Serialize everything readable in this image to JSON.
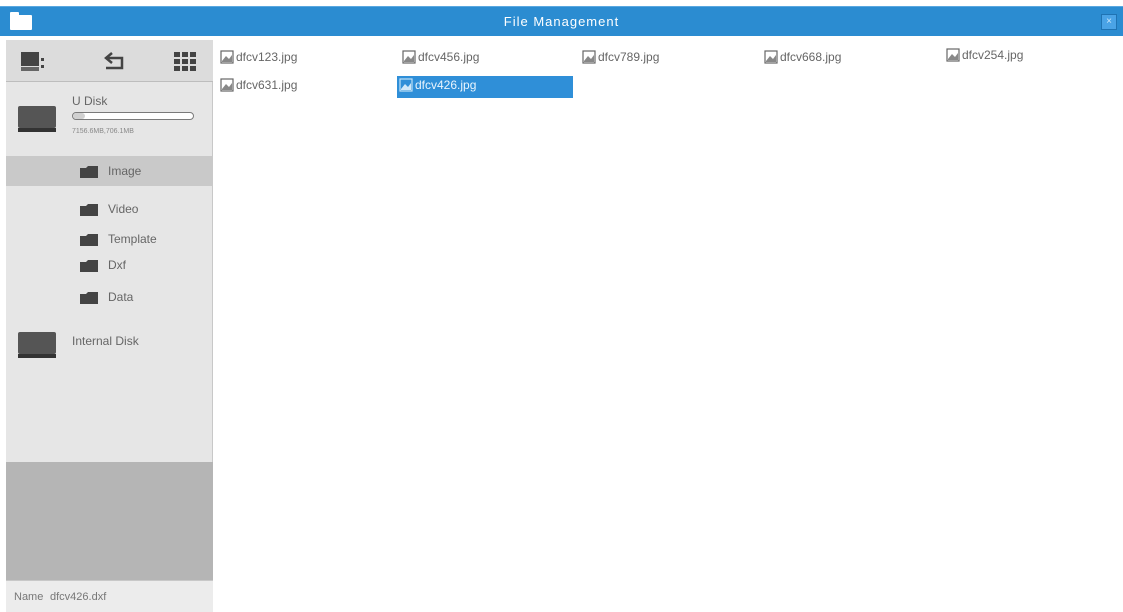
{
  "window": {
    "title": "File Management",
    "close_label": "×"
  },
  "toolbar": {
    "device_icon": "device-icon",
    "back_icon": "back-arrow-icon",
    "view_icon": "grid-view-icon"
  },
  "sidebar": {
    "u_disk": {
      "label": "U Disk",
      "capacity": "7156.6MB,706.1MB",
      "usage_fraction": 0.1
    },
    "folders": [
      {
        "label": "Image",
        "selected": true
      },
      {
        "label": "Video",
        "selected": false
      },
      {
        "label": "Template",
        "selected": false
      },
      {
        "label": "Dxf",
        "selected": false
      },
      {
        "label": "Data",
        "selected": false
      }
    ],
    "internal_disk": {
      "label": "Internal Disk"
    }
  },
  "status": {
    "name_label": "Name",
    "name_value": "dfcv426.dxf"
  },
  "files": [
    {
      "name": "dfcv123.jpg",
      "selected": false
    },
    {
      "name": "dfcv456.jpg",
      "selected": false
    },
    {
      "name": "dfcv789.jpg",
      "selected": false
    },
    {
      "name": "dfcv668.jpg",
      "selected": false
    },
    {
      "name": "dfcv254.jpg",
      "selected": false
    },
    {
      "name": "dfcv631.jpg",
      "selected": false
    },
    {
      "name": "dfcv426.jpg",
      "selected": true
    }
  ],
  "colors": {
    "titlebar": "#2b8cd1",
    "selection": "#2f8fd8",
    "sidebar": "#e6e6e6"
  }
}
